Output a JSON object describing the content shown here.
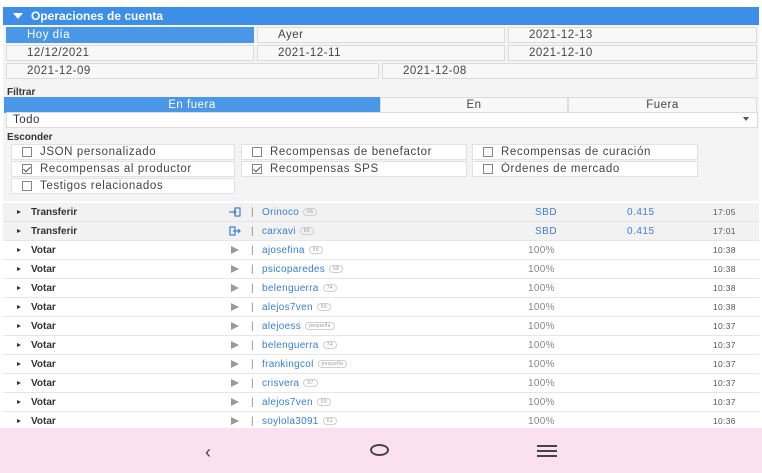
{
  "panel": {
    "title": "Operaciones de cuenta"
  },
  "dates": [
    "Hoy día",
    "Ayer",
    "2021-12-13",
    "12/12/2021",
    "2021-12-11",
    "2021-12-10",
    "2021-12-09",
    "2021-12-08"
  ],
  "filter": {
    "label": "Filtrar",
    "direction": [
      "En fuera",
      "En",
      "Fuera"
    ],
    "select_value": "Todo"
  },
  "hide": {
    "label": "Esconder",
    "options": [
      {
        "label": "JSON personalizado",
        "checked": false
      },
      {
        "label": "Recompensas de benefactor",
        "checked": false
      },
      {
        "label": "Recompensas de curación",
        "checked": false
      },
      {
        "label": "Recompensas al productor",
        "checked": true
      },
      {
        "label": "Recompensas SPS",
        "checked": true
      },
      {
        "label": "Órdenes de mercado",
        "checked": false
      },
      {
        "label": "Testigos relacionados",
        "checked": false
      }
    ]
  },
  "operations": [
    {
      "type": "Transferir",
      "kind": "transfer-in",
      "user": "Orinoco",
      "rep": "66",
      "asset": "SBD",
      "amount": "0.415",
      "time": "17:05"
    },
    {
      "type": "Transferir",
      "kind": "transfer-out",
      "user": "carxavi",
      "rep": "66",
      "asset": "SBD",
      "amount": "0.415",
      "time": "17:01"
    },
    {
      "type": "Votar",
      "kind": "vote",
      "user": "ajosefina",
      "rep": "58",
      "pct": "100%",
      "time": "10:38"
    },
    {
      "type": "Votar",
      "kind": "vote",
      "user": "psicoparedes",
      "rep": "58",
      "pct": "100%",
      "time": "10:38"
    },
    {
      "type": "Votar",
      "kind": "vote",
      "user": "belenguerra",
      "rep": "74",
      "pct": "100%",
      "time": "10:38"
    },
    {
      "type": "Votar",
      "kind": "vote",
      "user": "alejos7ven",
      "rep": "59",
      "pct": "100%",
      "time": "10:38"
    },
    {
      "type": "Votar",
      "kind": "vote",
      "user": "alejoess",
      "rep": "pequeña",
      "pct": "100%",
      "time": "10:37"
    },
    {
      "type": "Votar",
      "kind": "vote",
      "user": "belenguerra",
      "rep": "74",
      "pct": "100%",
      "time": "10:37"
    },
    {
      "type": "Votar",
      "kind": "vote",
      "user": "frankingcol",
      "rep": "pequeña",
      "pct": "100%",
      "time": "10:37"
    },
    {
      "type": "Votar",
      "kind": "vote",
      "user": "crisvera",
      "rep": "57",
      "pct": "100%",
      "time": "10:37"
    },
    {
      "type": "Votar",
      "kind": "vote",
      "user": "alejos7ven",
      "rep": "59",
      "pct": "100%",
      "time": "10:37"
    },
    {
      "type": "Votar",
      "kind": "vote",
      "user": "soylola3091",
      "rep": "61",
      "pct": "100%",
      "time": "10:36"
    }
  ],
  "colors": {
    "accent": "#3d8ee6",
    "link": "#3a7fcf",
    "navbar": "#fbe1f0"
  },
  "icons": {
    "back": "‹",
    "home": "circle",
    "menu": "hamburger"
  }
}
